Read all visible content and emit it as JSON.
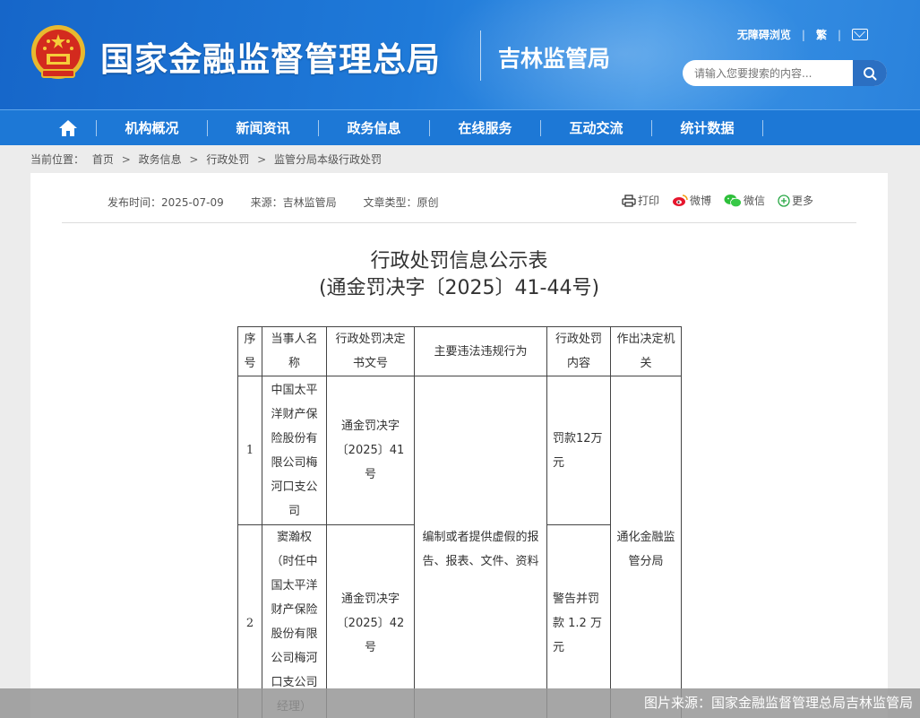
{
  "header": {
    "site_title": "国家金融监督管理总局",
    "sub_title": "吉林监管局",
    "accessibility_link": "无障碍浏览",
    "traditional_link": "繁",
    "search_placeholder": "请输入您要搜索的内容..."
  },
  "nav": {
    "items": [
      {
        "label": "机构概况"
      },
      {
        "label": "新闻资讯"
      },
      {
        "label": "政务信息"
      },
      {
        "label": "在线服务"
      },
      {
        "label": "互动交流"
      },
      {
        "label": "统计数据"
      }
    ]
  },
  "breadcrumb": {
    "prefix": "当前位置：",
    "items": [
      "首页",
      "政务信息",
      "行政处罚",
      "监管分局本级行政处罚"
    ],
    "sep": ">"
  },
  "meta": {
    "publish_label": "发布时间：",
    "publish_date": "2025-07-09",
    "source_label": "来源：",
    "source": "吉林监管局",
    "type_label": "文章类型：",
    "type": "原创"
  },
  "share": {
    "print": "打印",
    "weibo": "微博",
    "wechat": "微信",
    "more": "更多"
  },
  "doc": {
    "title_line1": "行政处罚信息公示表",
    "title_line2": "(通金罚决字〔2025〕41-44号)"
  },
  "table": {
    "headers": [
      "序号",
      "当事人名称",
      "行政处罚决定书文号",
      "主要违法违规行为",
      "行政处罚内容",
      "作出决定机关"
    ],
    "rows": [
      {
        "index": "1",
        "party": "中国太平洋财产保险股份有限公司梅河口支公司",
        "doc_no": "通金罚决字〔2025〕41号",
        "penalty": "罚款12万元"
      },
      {
        "index": "2",
        "party": "窦瀚权（时任中国太平洋财产保险股份有限公司梅河口支公司经理）",
        "doc_no": "通金罚决字〔2025〕42号",
        "penalty": "警告并罚款 1.2 万元"
      }
    ],
    "violation": "编制或者提供虚假的报告、报表、文件、资料",
    "authority": "通化金融监管分局"
  },
  "caption": "图片来源：国家金融监督管理总局吉林监管局"
}
